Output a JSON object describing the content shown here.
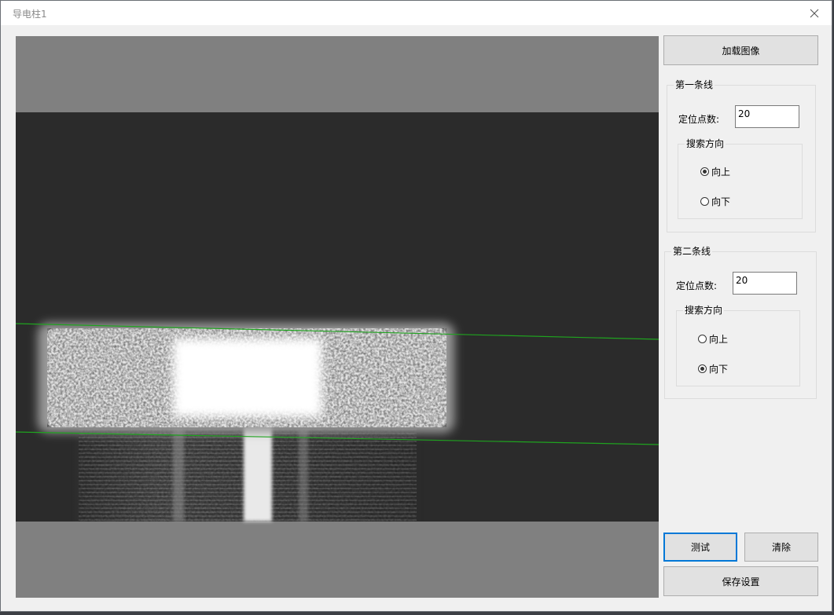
{
  "window": {
    "title": "导电柱1",
    "close_icon": "close-icon"
  },
  "buttons": {
    "load_image": "加载图像",
    "test": "测试",
    "clear": "清除",
    "save_settings": "保存设置"
  },
  "line1": {
    "group_title": "第一条线",
    "points_label": "定位点数:",
    "points_value": "20",
    "direction_title": "搜索方向",
    "options": [
      {
        "label": "向上",
        "checked": true
      },
      {
        "label": "向下",
        "checked": false
      }
    ]
  },
  "line2": {
    "group_title": "第二条线",
    "points_label": "定位点数:",
    "points_value": "20",
    "direction_title": "搜索方向",
    "options": [
      {
        "label": "向上",
        "checked": false
      },
      {
        "label": "向下",
        "checked": true
      }
    ]
  },
  "colors": {
    "accent": "#0078d7",
    "detected_line": "#1fa31f"
  }
}
